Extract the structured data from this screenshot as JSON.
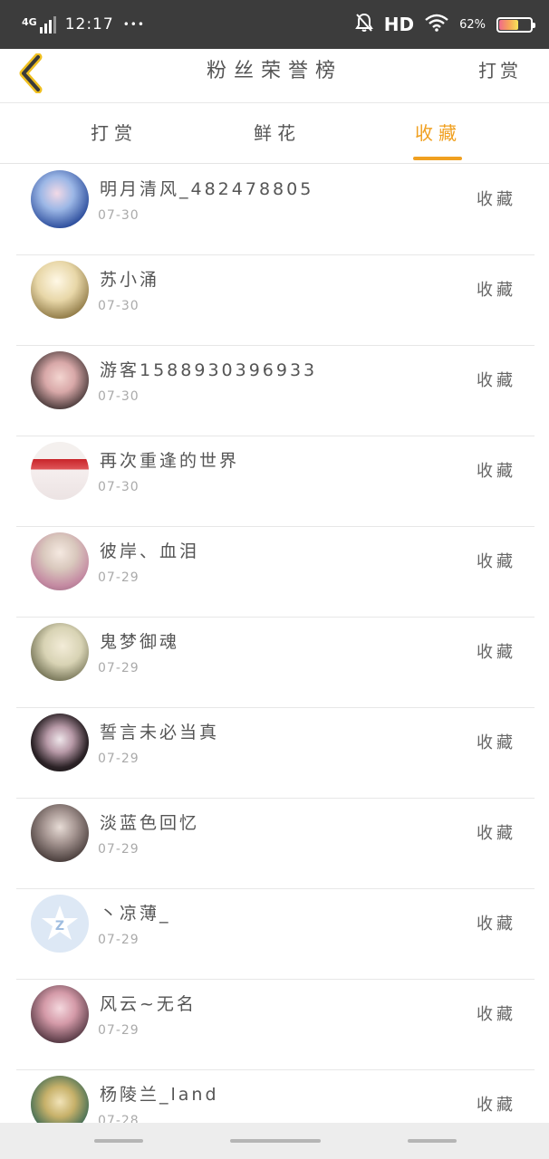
{
  "status_bar": {
    "network": "4G",
    "time": "12:17",
    "dots": "•••",
    "hd": "HD",
    "battery_percent": "62%",
    "battery_level": 0.62,
    "icons": [
      "signal-icon",
      "mute-bell-icon",
      "wifi-icon",
      "battery-icon"
    ]
  },
  "header": {
    "back_icon": "chevron-left-icon",
    "title": "粉丝荣誉榜",
    "action": "打赏",
    "accent_color": "#f0a020"
  },
  "tabs": [
    {
      "label": "打赏",
      "active": false
    },
    {
      "label": "鲜花",
      "active": false
    },
    {
      "label": "收藏",
      "active": true
    }
  ],
  "list": [
    {
      "name": "明月清风_482478805",
      "date": "07-30",
      "type": "收藏",
      "avatar_icon": "avatar-image"
    },
    {
      "name": "苏小涌",
      "date": "07-30",
      "type": "收藏",
      "avatar_icon": "avatar-image"
    },
    {
      "name": "游客1588930396933",
      "date": "07-30",
      "type": "收藏",
      "avatar_icon": "avatar-image"
    },
    {
      "name": "再次重逢的世界",
      "date": "07-30",
      "type": "收藏",
      "avatar_icon": "avatar-image"
    },
    {
      "name": "彼岸、血泪",
      "date": "07-29",
      "type": "收藏",
      "avatar_icon": "avatar-image"
    },
    {
      "name": "鬼梦御魂",
      "date": "07-29",
      "type": "收藏",
      "avatar_icon": "avatar-image"
    },
    {
      "name": "誓言未必当真",
      "date": "07-29",
      "type": "收藏",
      "avatar_icon": "avatar-image"
    },
    {
      "name": "淡蓝色回忆",
      "date": "07-29",
      "type": "收藏",
      "avatar_icon": "avatar-image"
    },
    {
      "name": "丶凉薄_",
      "date": "07-29",
      "type": "收藏",
      "avatar_icon": "qq-default-avatar-icon"
    },
    {
      "name": "风云~无名",
      "date": "07-29",
      "type": "收藏",
      "avatar_icon": "avatar-image"
    },
    {
      "name": "杨陵兰_land",
      "date": "07-28",
      "type": "收藏",
      "avatar_icon": "avatar-image"
    }
  ]
}
